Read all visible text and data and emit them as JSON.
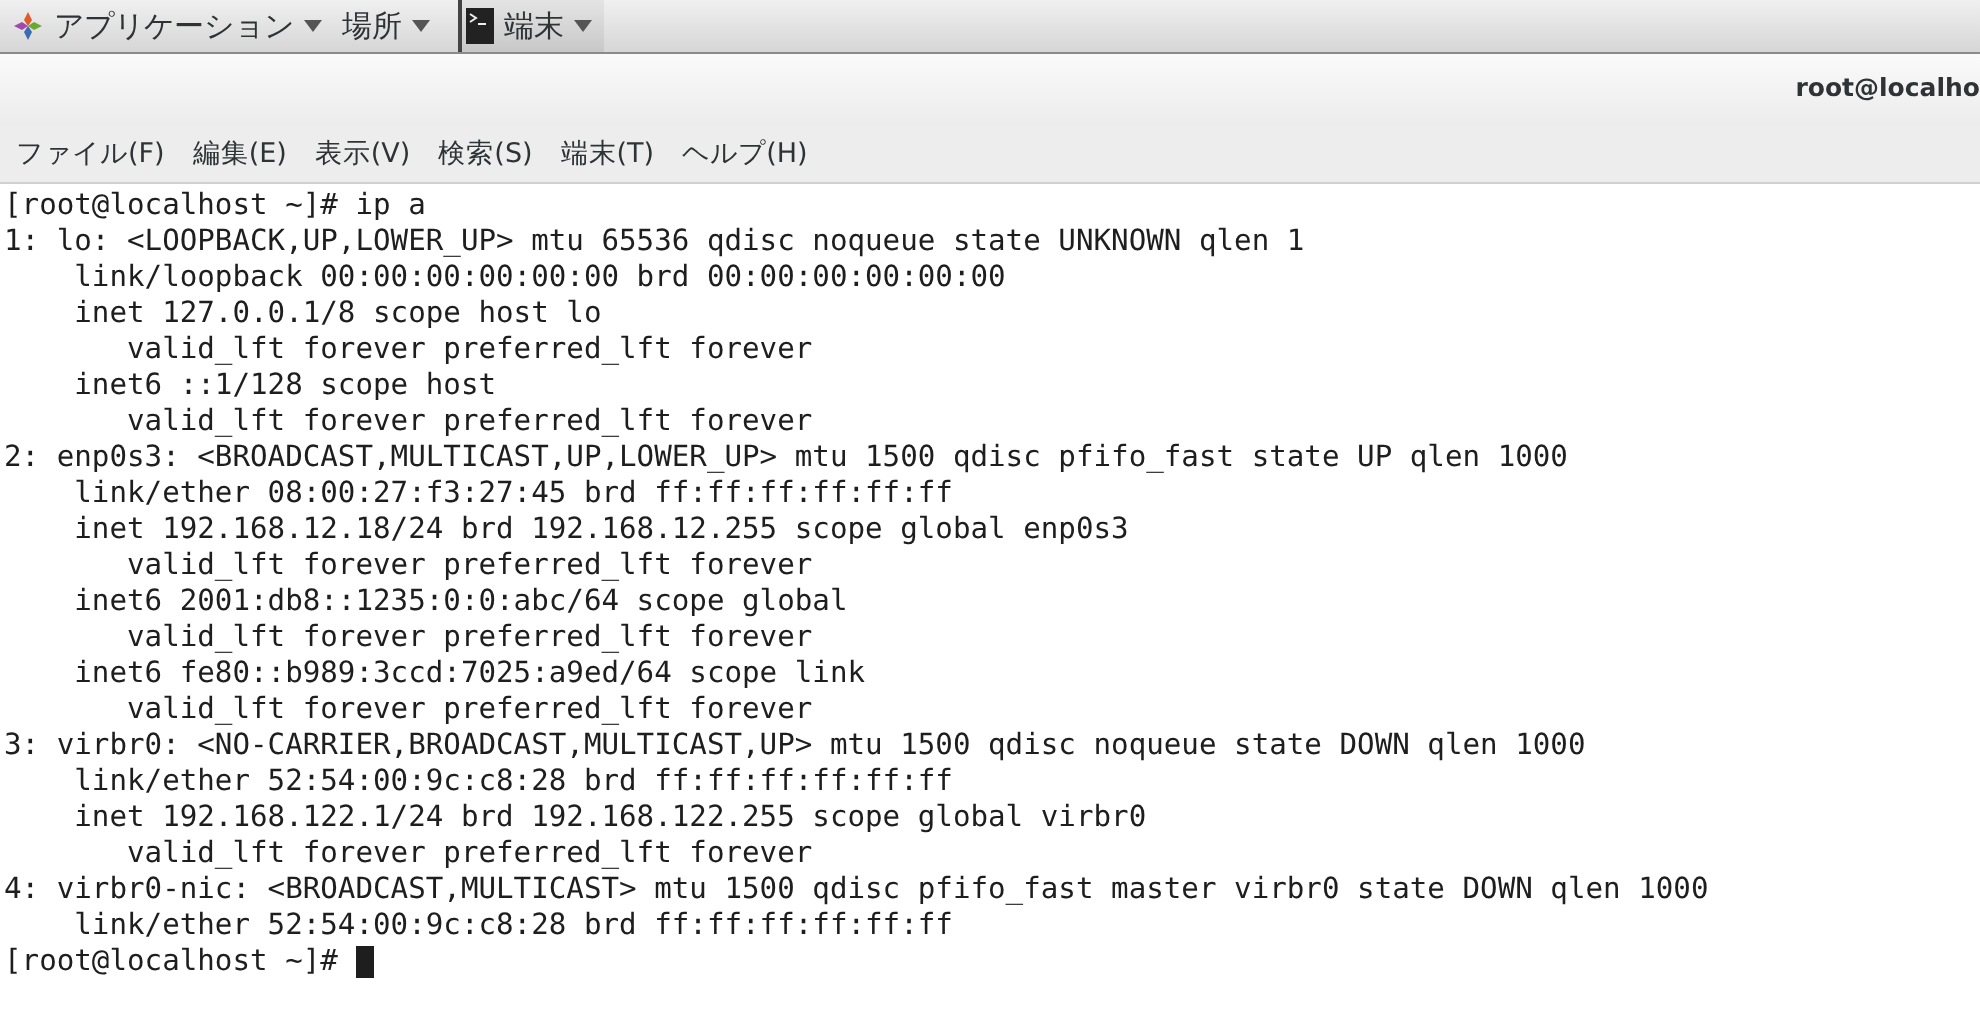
{
  "top_panel": {
    "items": [
      {
        "kind": "apps",
        "label": "アプリケーション"
      },
      {
        "kind": "places",
        "label": "場所"
      },
      {
        "kind": "task",
        "label": "端末"
      }
    ]
  },
  "window": {
    "title": "root@localho"
  },
  "menu_bar": [
    "ファイル(F)",
    "編集(E)",
    "表示(V)",
    "検索(S)",
    "端末(T)",
    "ヘルプ(H)"
  ],
  "terminal": {
    "lines": [
      "[root@localhost ~]# ip a",
      "1: lo: <LOOPBACK,UP,LOWER_UP> mtu 65536 qdisc noqueue state UNKNOWN qlen 1",
      "    link/loopback 00:00:00:00:00:00 brd 00:00:00:00:00:00",
      "    inet 127.0.0.1/8 scope host lo",
      "       valid_lft forever preferred_lft forever",
      "    inet6 ::1/128 scope host",
      "       valid_lft forever preferred_lft forever",
      "2: enp0s3: <BROADCAST,MULTICAST,UP,LOWER_UP> mtu 1500 qdisc pfifo_fast state UP qlen 1000",
      "    link/ether 08:00:27:f3:27:45 brd ff:ff:ff:ff:ff:ff",
      "    inet 192.168.12.18/24 brd 192.168.12.255 scope global enp0s3",
      "       valid_lft forever preferred_lft forever",
      "    inet6 2001:db8::1235:0:0:abc/64 scope global",
      "       valid_lft forever preferred_lft forever",
      "    inet6 fe80::b989:3ccd:7025:a9ed/64 scope link",
      "       valid_lft forever preferred_lft forever",
      "3: virbr0: <NO-CARRIER,BROADCAST,MULTICAST,UP> mtu 1500 qdisc noqueue state DOWN qlen 1000",
      "    link/ether 52:54:00:9c:c8:28 brd ff:ff:ff:ff:ff:ff",
      "    inet 192.168.122.1/24 brd 192.168.122.255 scope global virbr0",
      "       valid_lft forever preferred_lft forever",
      "4: virbr0-nic: <BROADCAST,MULTICAST> mtu 1500 qdisc pfifo_fast master virbr0 state DOWN qlen 1000",
      "    link/ether 52:54:00:9c:c8:28 brd ff:ff:ff:ff:ff:ff"
    ],
    "prompt": "[root@localhost ~]#"
  }
}
